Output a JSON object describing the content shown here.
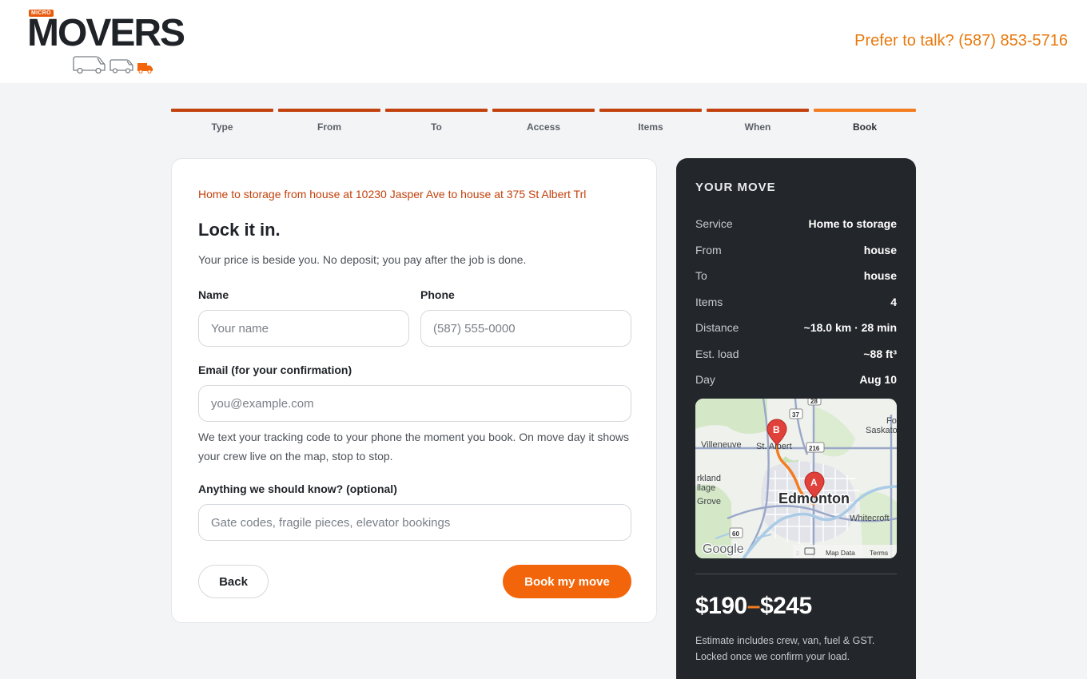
{
  "brand": {
    "micro": "MICRO",
    "name": "MOVERS",
    "accent": "#f2650a"
  },
  "header": {
    "phone_cta": "Prefer to talk? (587) 853-5716"
  },
  "steps": [
    {
      "label": "Type"
    },
    {
      "label": "From"
    },
    {
      "label": "To"
    },
    {
      "label": "Access"
    },
    {
      "label": "Items"
    },
    {
      "label": "When"
    },
    {
      "label": "Book"
    }
  ],
  "form": {
    "summary": "Home to storage from house at 10230 Jasper Ave to house at 375 St Albert Trl",
    "title": "Lock it in.",
    "subtitle": "Your price is beside you. No deposit; you pay after the job is done.",
    "name_label": "Name",
    "name_placeholder": "Your name",
    "phone_label": "Phone",
    "phone_placeholder": "(587) 555-0000",
    "email_label": "Email (for your confirmation)",
    "email_placeholder": "you@example.com",
    "email_helper": "We text your tracking code to your phone the moment you book. On move day it shows your crew live on the map, stop to stop.",
    "notes_label": "Anything we should know? (optional)",
    "notes_placeholder": "Gate codes, fragile pieces, elevator bookings",
    "back_label": "Back",
    "book_label": "Book my move"
  },
  "move": {
    "title": "YOUR MOVE",
    "rows": [
      {
        "k": "Service",
        "v": "Home to storage"
      },
      {
        "k": "From",
        "v": "house"
      },
      {
        "k": "To",
        "v": "house"
      },
      {
        "k": "Items",
        "v": "4"
      },
      {
        "k": "Distance",
        "v": "~18.0 km · 28 min"
      },
      {
        "k": "Est. load",
        "v": "~88 ft³"
      },
      {
        "k": "Day",
        "v": "Aug 10"
      }
    ],
    "map": {
      "city": "Edmonton",
      "places": [
        "Villeneuve",
        "St. Albert",
        "Saskato",
        "rkland",
        "llage",
        "Grove",
        "Whitecroft",
        "Fo"
      ],
      "shields": [
        "28",
        "37",
        "216",
        "60",
        "2"
      ],
      "marker_a": "A",
      "marker_b": "B",
      "logo": "Google",
      "attribution": "Map Data",
      "terms": "Terms"
    },
    "price_low": "$190",
    "price_sep": "–",
    "price_high": "$245",
    "fine_print": "Estimate includes crew, van, fuel & GST. Locked once we confirm your load."
  }
}
